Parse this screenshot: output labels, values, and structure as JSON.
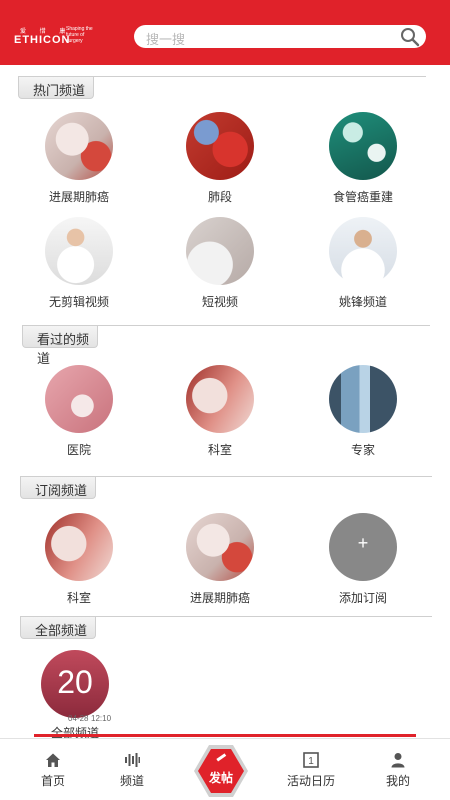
{
  "header": {
    "logo": {
      "brand": "ETHICON",
      "chinese": "爱 惜 康",
      "tagline": "Shaping the future of surgery"
    },
    "search_placeholder": "搜一搜"
  },
  "sections": {
    "hot": {
      "title": "热门频道",
      "items": [
        {
          "label": "进展期肺癌",
          "image": "lung-image"
        },
        {
          "label": "肺段",
          "image": "lung-segment-image"
        },
        {
          "label": "食管癌重建",
          "image": "surgery-team-image"
        },
        {
          "label": "无剪辑视频",
          "image": "doctors-image"
        },
        {
          "label": "短视频",
          "image": "doctor-writing-image"
        },
        {
          "label": "姚锋频道",
          "image": "doctor-portrait-image"
        }
      ]
    },
    "viewed": {
      "title": "看过的频道",
      "items": [
        {
          "label": "医院",
          "image": "hospital-image"
        },
        {
          "label": "科室",
          "image": "department-image"
        },
        {
          "label": "专家",
          "image": "expert-image"
        }
      ]
    },
    "subscribed": {
      "title": "订阅频道",
      "items": [
        {
          "label": "科室",
          "image": "department-image"
        },
        {
          "label": "进展期肺癌",
          "image": "lung-image"
        },
        {
          "label": "添加订阅",
          "symbol": "+"
        }
      ]
    },
    "all": {
      "title": "全部频道",
      "item": {
        "label": "全部频道",
        "day": "20",
        "date": "04-28",
        "time": "12:10"
      }
    }
  },
  "bottom_nav": [
    {
      "label": "首页",
      "icon": "home-icon"
    },
    {
      "label": "频道",
      "icon": "channel-icon"
    },
    {
      "label": "发帖",
      "icon": "pencil-icon"
    },
    {
      "label": "活动日历",
      "icon": "calendar-icon",
      "badge": "1"
    },
    {
      "label": "我的",
      "icon": "user-icon"
    }
  ],
  "colors": {
    "brand_red": "#e0222a",
    "add_gray": "#888888",
    "text": "#333333"
  }
}
